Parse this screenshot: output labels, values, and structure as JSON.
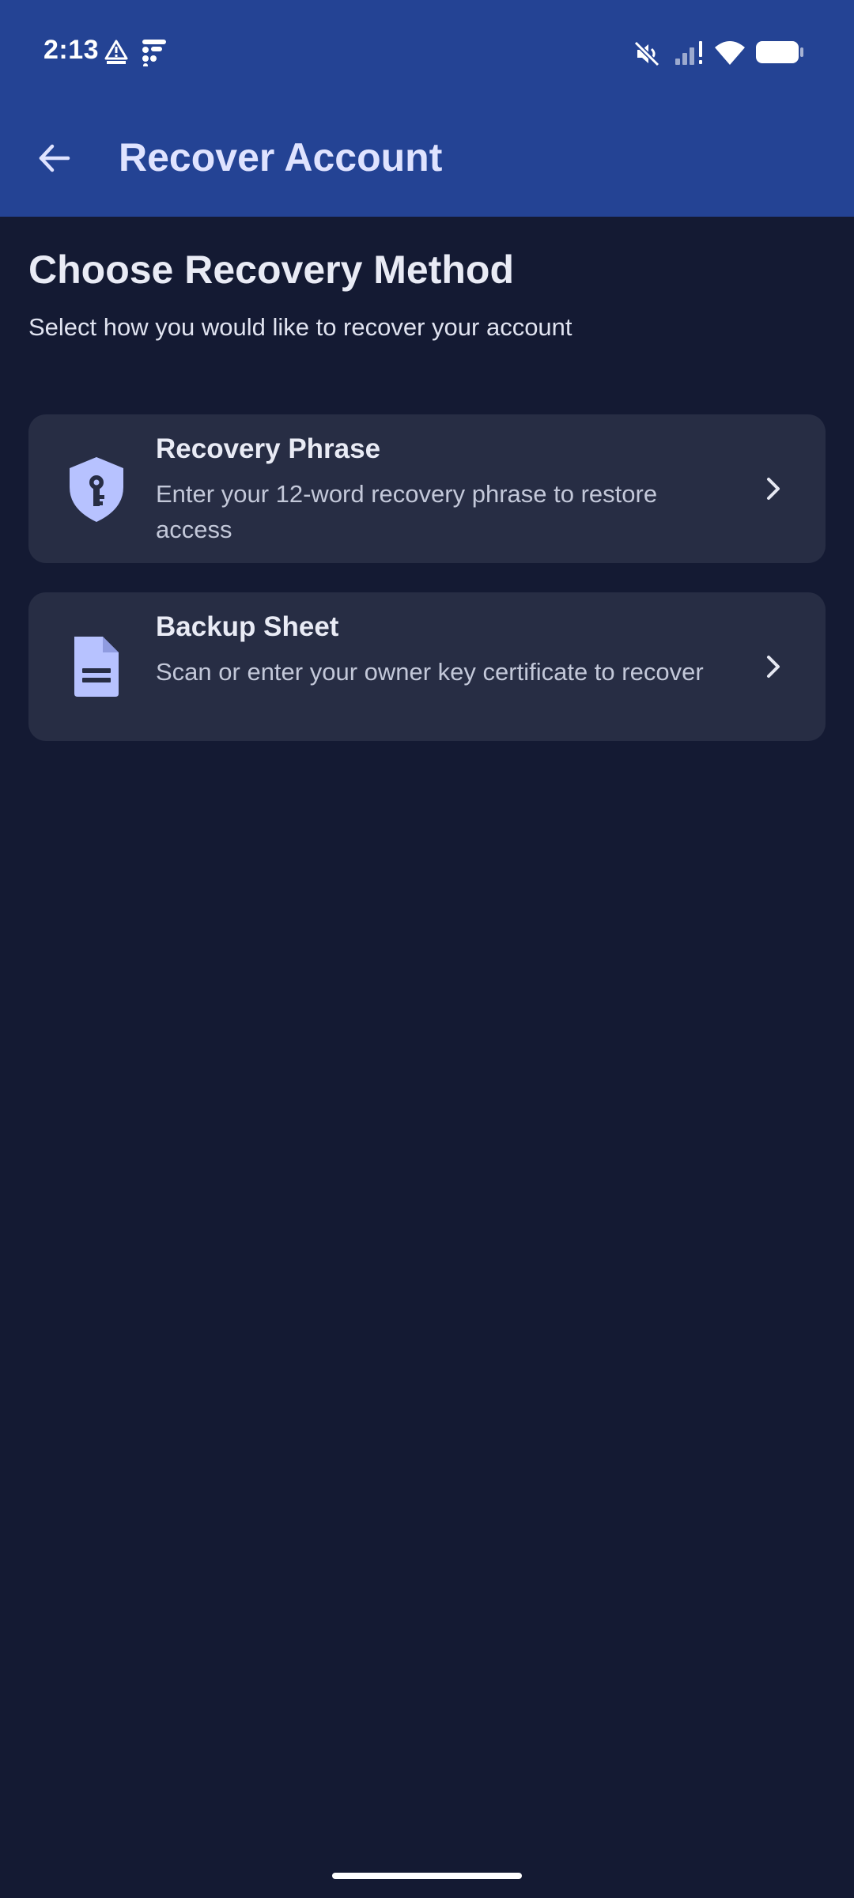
{
  "status_bar": {
    "time": "2:13",
    "icons": [
      "alert-triangle-icon",
      "grid-dots-icon",
      "mute-icon",
      "signal-icon",
      "wifi-icon",
      "battery-icon"
    ]
  },
  "app_bar": {
    "title": "Recover Account",
    "back_icon": "arrow-back-icon"
  },
  "main": {
    "title": "Choose Recovery Method",
    "subtitle": "Select how you would like to recover your account",
    "options": [
      {
        "title": "Recovery Phrase",
        "description": "Enter your 12-word recovery phrase to restore access",
        "icon": "shield-key-icon"
      },
      {
        "title": "Backup Sheet",
        "description": "Scan or enter your owner key certificate to recover",
        "icon": "document-icon"
      }
    ]
  },
  "colors": {
    "app_bar": "#244394",
    "background": "#141a33",
    "card": "#272d44",
    "icon_accent": "#b7c2ff"
  }
}
